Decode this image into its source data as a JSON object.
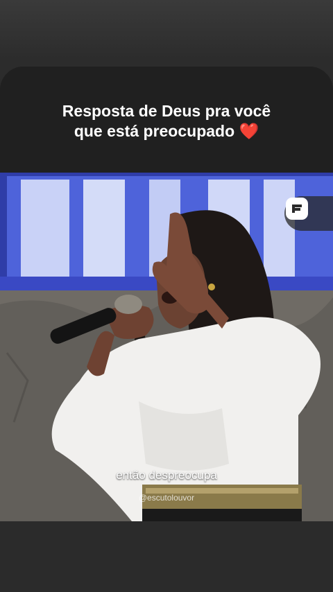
{
  "post": {
    "caption_line1": "Resposta de Deus pra você",
    "caption_line2": "que está preocupado",
    "caption_emoji": "❤️",
    "subtitle": "então despreocupa",
    "watermark": "@escutolouvor"
  },
  "icons": {
    "brand_logo": "e-logo-icon"
  },
  "colors": {
    "heart": "#e02424",
    "neon_sign": "#3b5bff"
  }
}
